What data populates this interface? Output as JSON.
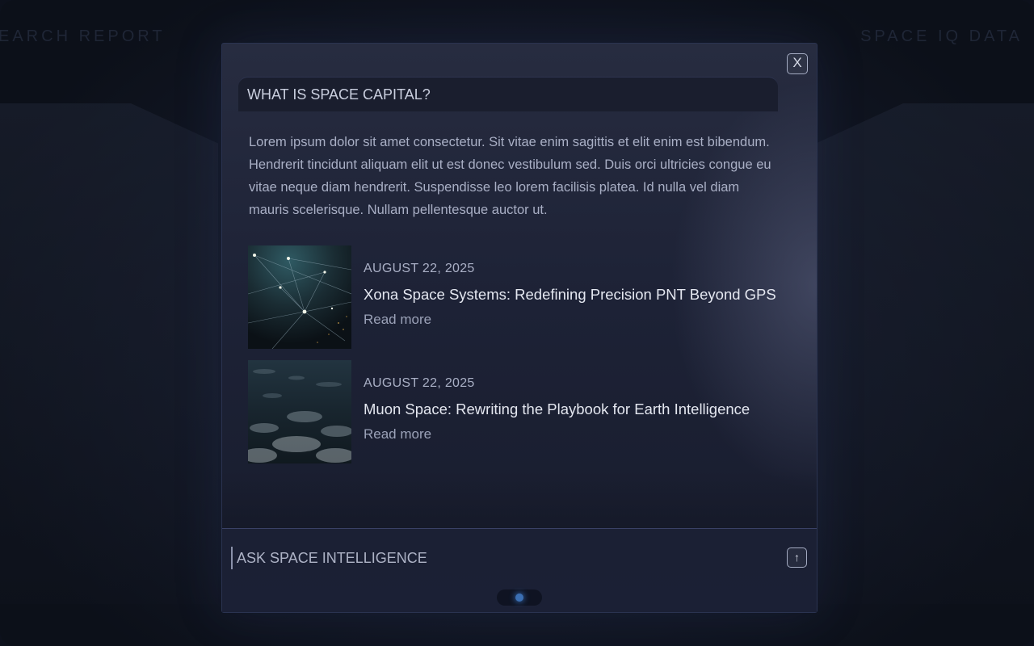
{
  "background": {
    "left_label": "EARCH REPORT",
    "right_label": "SPACE IQ DATA"
  },
  "modal": {
    "close_label": "X",
    "question": "WHAT IS SPACE CAPITAL?",
    "answer": "Lorem ipsum dolor sit amet consectetur. Sit vitae enim sagittis et elit enim est bibendum. Hendrerit tincidunt aliquam elit ut est donec vestibulum sed. Duis orci ultricies congue eu vitae neque diam hendrerit. Suspendisse leo lorem facilisis platea. Id nulla vel diam mauris scelerisque. Nullam pellentesque auctor ut.",
    "articles": [
      {
        "date": "AUGUST 22, 2025",
        "title": "Xona Space Systems: Redefining Precision PNT Beyond GPS",
        "read_more": "Read more",
        "thumb_icon": "satellite-network-image"
      },
      {
        "date": "AUGUST 22, 2025",
        "title": "Muon Space: Rewriting the Playbook for Earth Intelligence",
        "read_more": "Read more",
        "thumb_icon": "earth-clouds-image"
      }
    ],
    "input": {
      "placeholder": "ASK SPACE INTELLIGENCE",
      "value": ""
    },
    "send_icon": "arrow-up-icon",
    "send_label": "↑"
  },
  "colors": {
    "accent": "#3f82d8",
    "panel": "#1d2236",
    "text_primary": "#e4e7f0",
    "text_secondary": "#a9afc5"
  }
}
